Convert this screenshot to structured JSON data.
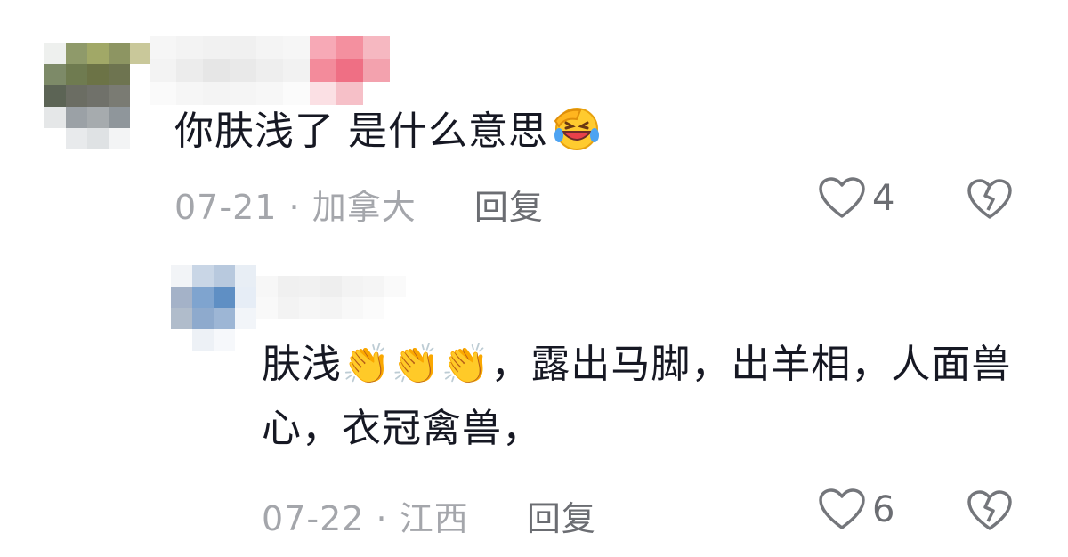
{
  "comments": [
    {
      "text": "你肤浅了 是什么意思",
      "date": "07-21",
      "location": "加拿大",
      "reply_label": "回复",
      "likes": "4"
    },
    {
      "text": "肤浅👏👏👏，露出马脚，出羊相，人面兽心，衣冠禽兽，",
      "date": "07-22",
      "location": "江西",
      "reply_label": "回复",
      "likes": "6"
    }
  ],
  "separator": "·",
  "icons": [
    "grinning-squinting-face-with-tears-icon",
    "clapping-hands-icon",
    "heart-outline-icon",
    "broken-heart-icon"
  ],
  "colors": {
    "text": "#161823",
    "meta": "#a4a6ab",
    "reply": "#6b6d72"
  }
}
